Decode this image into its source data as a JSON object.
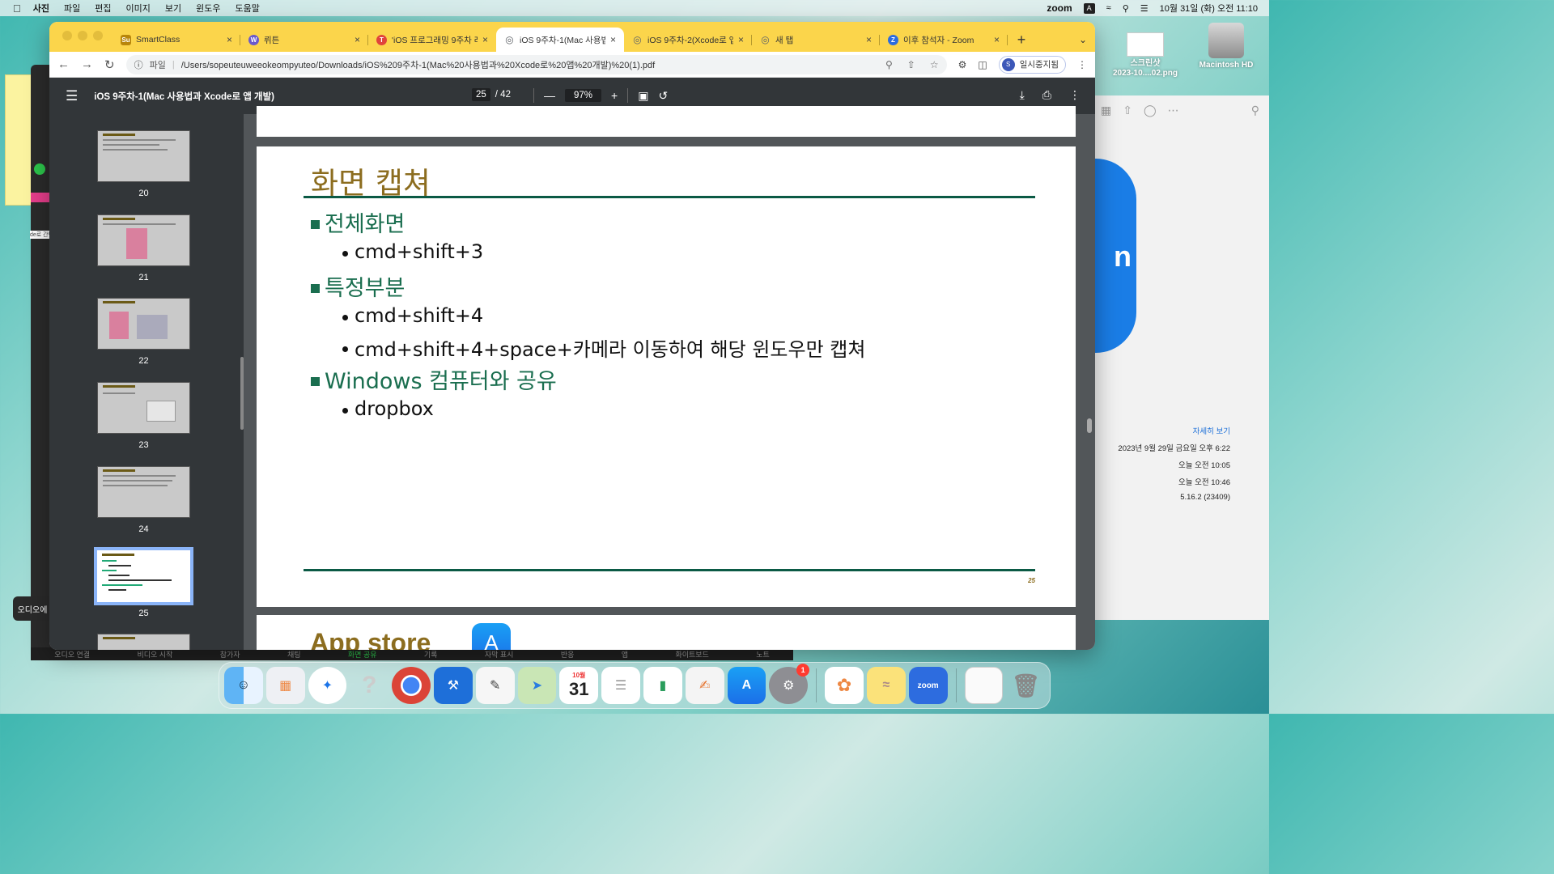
{
  "menubar": {
    "app": "사진",
    "items": [
      "파일",
      "편집",
      "이미지",
      "보기",
      "윈도우",
      "도움말"
    ],
    "zoom": "zoom",
    "input_source": "A",
    "datetime": "10월 31일 (화) 오전 11:10"
  },
  "tabs": [
    {
      "label": "SmartClass",
      "color": "#b8860b",
      "glyph": "Su"
    },
    {
      "label": "뤼튼",
      "color": "#6a5acd",
      "glyph": "W"
    },
    {
      "label": "'iOS 프로그래밍 9주차 레",
      "color": "#e0443c",
      "glyph": "T"
    },
    {
      "label": "iOS 9주차-1(Mac 사용법",
      "color": "#5f6368",
      "glyph": "◎"
    },
    {
      "label": "iOS 9주차-2(Xcode로 앱",
      "color": "#5f6368",
      "glyph": "◎"
    },
    {
      "label": "새 탭",
      "color": "#5f6368",
      "glyph": "◎"
    },
    {
      "label": "이후 참석자 - Zoom",
      "color": "#2d6cdf",
      "glyph": "Z"
    }
  ],
  "address": {
    "scheme": "파일",
    "url": "/Users/sopeuteuweeokeompyuteo/Downloads/iOS%209주차-1(Mac%20사용법과%20Xcode로%20앱%20개발)%20(1).pdf"
  },
  "profile": {
    "initial": "S",
    "label": "일시중지됨"
  },
  "pdf": {
    "title": "iOS 9주차-1(Mac 사용법과 Xcode로 앱 개발)",
    "current_page": "25",
    "total_pages": "/ 42",
    "zoom": "97%"
  },
  "thumbnails": [
    "20",
    "21",
    "22",
    "23",
    "24",
    "25"
  ],
  "slide": {
    "title": "화면 캡쳐",
    "b1_full": "전체화면",
    "b2_full": "cmd+shift+3",
    "b1_part": "특정부분",
    "b2_part1": "cmd+shift+4",
    "b2_part2": "cmd+shift+4+space+카메라 이동하여 해당 윈도우만 캡쳐",
    "b1_win": "Windows 컴퓨터와 공유",
    "b2_win": "dropbox",
    "page_number": "25"
  },
  "next_slide": {
    "title": "App store"
  },
  "photo_info": {
    "link": "자세히 보기",
    "created": "2023년 9월 29일 금요일 오후 6:22",
    "modified": "오늘 오전 10:05",
    "opened": "오늘 오전 10:46",
    "version": "5.16.2 (23409)"
  },
  "desktop": {
    "screenshot_name": "스크린샷\n2023-10....02.png",
    "hd_name": "Macintosh HD"
  },
  "zoom_toolbar": [
    "오디오 연결",
    "비디오 시작",
    "참가자",
    "채팅",
    "화면 공유",
    "기록",
    "자막 표시",
    "반응",
    "앱",
    "화이트보드",
    "노트"
  ],
  "audio_popup": "오디오에",
  "sidebar_label": "de로 간단",
  "dock": {
    "calendar_month": "10월",
    "calendar_day": "31",
    "settings_badge": "1",
    "zoom_label": "zoom"
  }
}
